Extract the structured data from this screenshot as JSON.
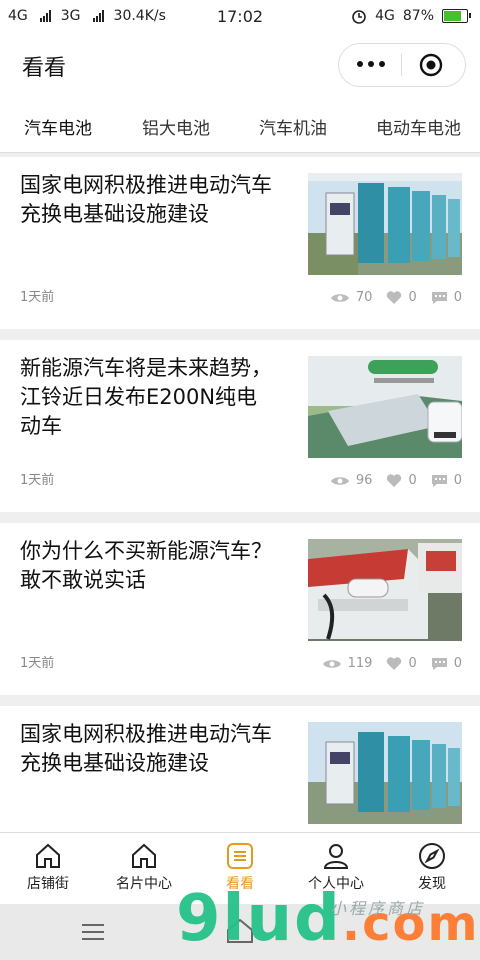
{
  "status": {
    "left_net1": "4G",
    "left_net2": "3G",
    "speed": "30.4K/s",
    "time": "17:02",
    "right_net": "4G",
    "battery_text": "87%",
    "battery_level": 0.87
  },
  "header": {
    "title": "看看"
  },
  "tabs": [
    {
      "label": "汽车电池"
    },
    {
      "label": "铝大电池"
    },
    {
      "label": "汽车机油"
    },
    {
      "label": "电动车电池"
    }
  ],
  "articles": [
    {
      "title": "国家电网积极推进电动汽车充换电基础设施建设",
      "time": "1天前",
      "views": "70",
      "likes": "0",
      "comments": "0"
    },
    {
      "title": "新能源汽车将是未来趋势，江铃近日发布E200N纯电动车",
      "time": "1天前",
      "views": "96",
      "likes": "0",
      "comments": "0"
    },
    {
      "title": "你为什么不买新能源汽车？敢不敢说实话",
      "time": "1天前",
      "views": "119",
      "likes": "0",
      "comments": "0"
    },
    {
      "title": "国家电网积极推进电动汽车充换电基础设施建设",
      "time": "",
      "views": "",
      "likes": "",
      "comments": ""
    }
  ],
  "tabbar": [
    {
      "label": "店铺街",
      "icon": "home-icon"
    },
    {
      "label": "名片中心",
      "icon": "home-icon"
    },
    {
      "label": "看看",
      "icon": "list-icon"
    },
    {
      "label": "个人中心",
      "icon": "person-icon"
    },
    {
      "label": "发现",
      "icon": "compass-icon"
    }
  ],
  "watermark": {
    "brand": "9lud",
    "domain": ".com",
    "tagline": "小程序商店"
  },
  "colors": {
    "accent": "#e59a1c",
    "battery": "#46c02b"
  }
}
